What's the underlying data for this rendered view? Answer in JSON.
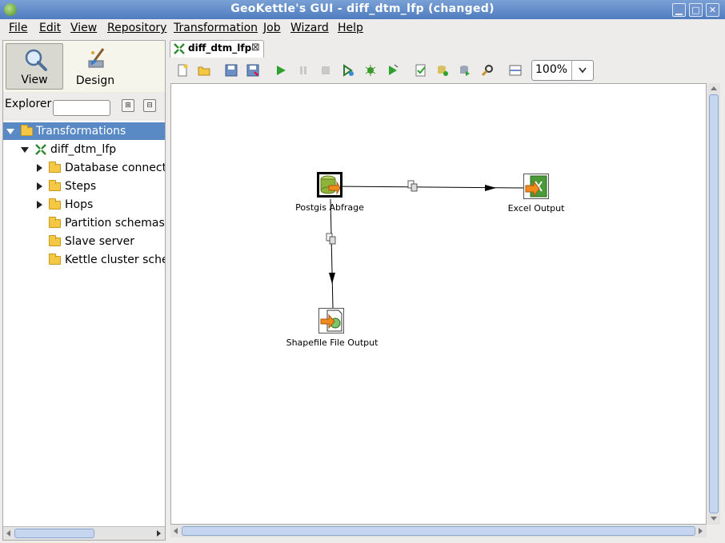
{
  "window": {
    "title": "GeoKettle's GUI - diff_dtm_lfp (changed)",
    "controls": [
      "minimize",
      "maximize",
      "close"
    ]
  },
  "menu": {
    "file": "File",
    "edit": "Edit",
    "view": "View",
    "repository": "Repository",
    "transformation": "Transformation",
    "job": "Job",
    "wizard": "Wizard",
    "help": "Help"
  },
  "perspectives": {
    "view": "View",
    "design": "Design",
    "active": "View"
  },
  "explorer": {
    "label": "Explorer",
    "search_value": ""
  },
  "tree": {
    "root": "Transformations",
    "transformation": "diff_dtm_lfp",
    "children": [
      "Database connections",
      "Steps",
      "Hops",
      "Partition schemas",
      "Slave server",
      "Kettle cluster schemas"
    ]
  },
  "editor": {
    "tab_label": "diff_dtm_lfp",
    "zoom": "100%"
  },
  "toolbar_icons": [
    "new-icon",
    "open-icon",
    "save-icon",
    "save-as-icon",
    "run-icon",
    "pause-icon",
    "stop-icon",
    "preview-icon",
    "debug-icon",
    "replay-icon",
    "verify-icon",
    "impact-icon",
    "sql-icon",
    "explore-db-icon",
    "show-results-icon"
  ],
  "steps": {
    "input": "Postgis Abfrage",
    "excel": "Excel Output",
    "shapefile": "Shapefile File Output"
  },
  "colors": {
    "titlebar": "#5a85c6",
    "selection": "#5a8ac6",
    "folder": "#f4c845"
  }
}
